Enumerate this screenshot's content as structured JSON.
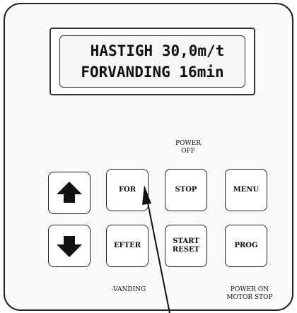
{
  "display": {
    "line1": "HASTIGH 30,0m/t",
    "line2": "FORVANDING 16min"
  },
  "buttons": {
    "up": {
      "icon": "arrow-up-icon"
    },
    "down": {
      "icon": "arrow-down-icon"
    },
    "for_label": "FOR",
    "efter_label": "EFTER",
    "stop_label": "STOP",
    "start_reset_label": "START\nRESET",
    "menu_label": "MENU",
    "prog_label": "PROG"
  },
  "captions": {
    "power_off": "POWER\nOFF",
    "vanding": "-VANDING",
    "power_on_motor_stop": "POWER ON\nMOTOR STOP"
  }
}
